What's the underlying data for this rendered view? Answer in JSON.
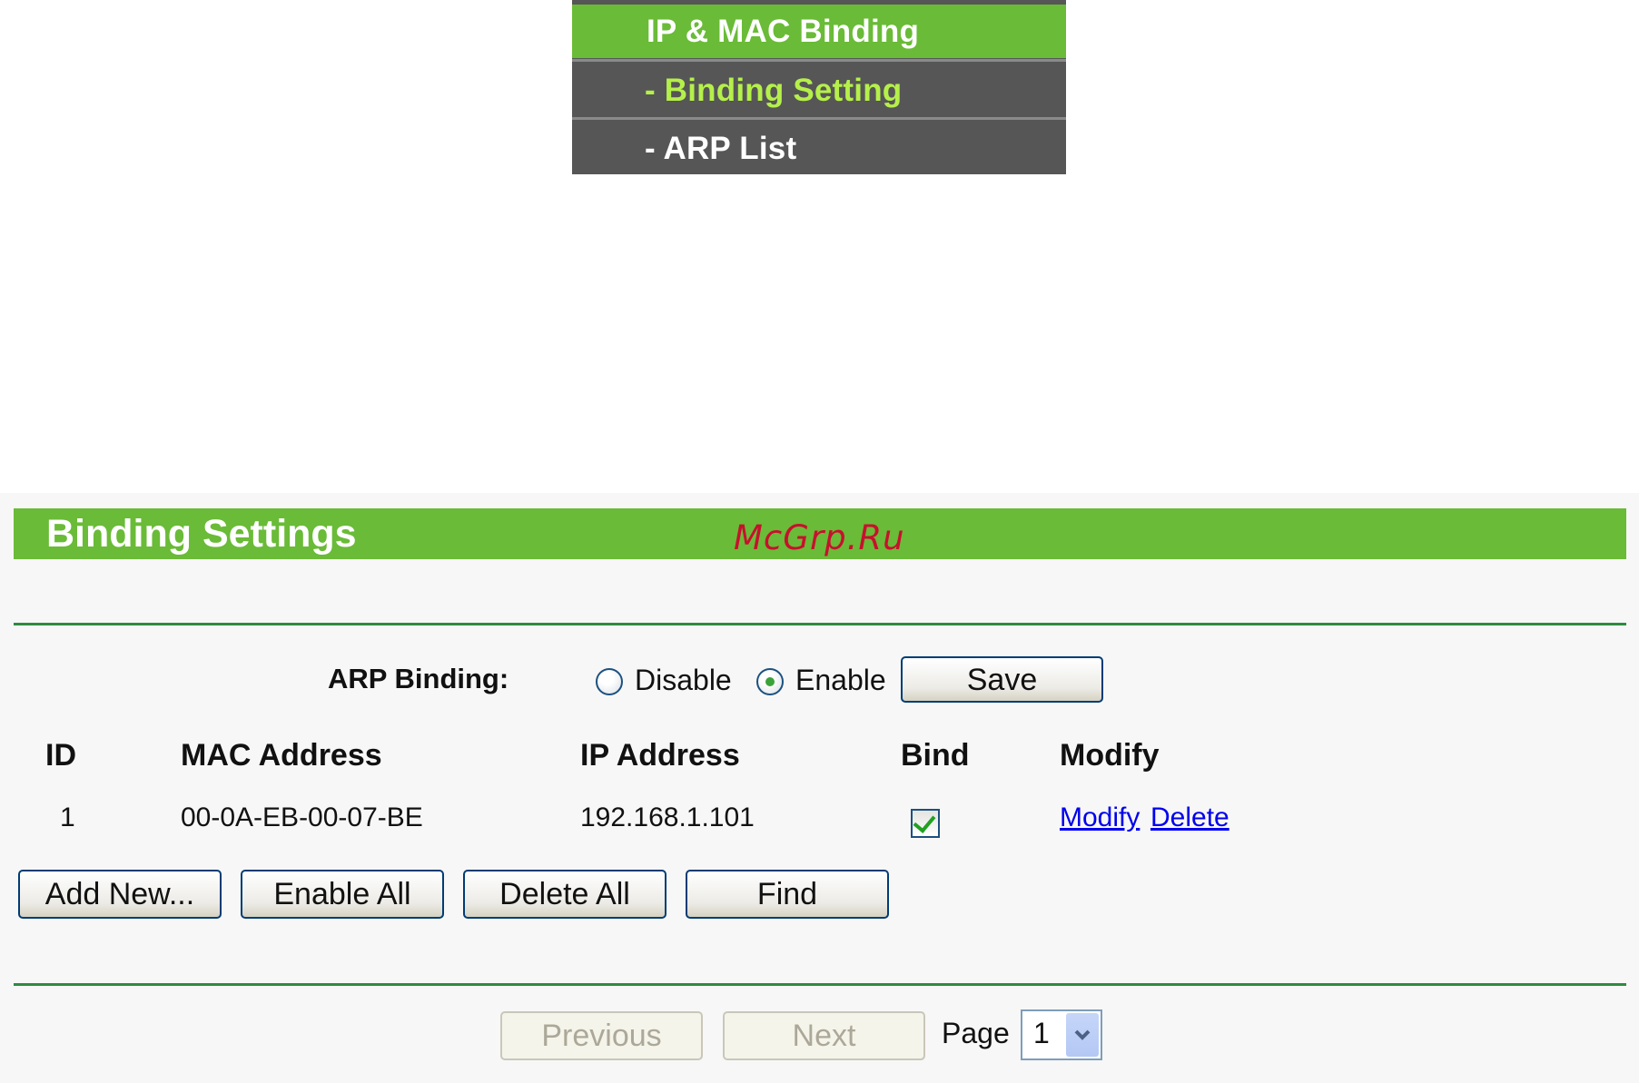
{
  "menu": {
    "header": "IP & MAC Binding",
    "items": [
      {
        "label": "- Binding Setting",
        "active": true
      },
      {
        "label": "- ARP List",
        "active": false
      }
    ]
  },
  "panel": {
    "title": "Binding Settings",
    "watermark": "McGrp.Ru",
    "arp_binding": {
      "label": "ARP Binding:",
      "options": [
        "Disable",
        "Enable"
      ],
      "selected": "Enable",
      "save_label": "Save"
    },
    "table": {
      "columns": [
        "ID",
        "MAC Address",
        "IP Address",
        "Bind",
        "Modify"
      ],
      "rows": [
        {
          "id": "1",
          "mac": "00-0A-EB-00-07-BE",
          "ip": "192.168.1.101",
          "bind": true,
          "actions": [
            "Modify",
            "Delete"
          ]
        }
      ]
    },
    "buttons": {
      "add_new": "Add New...",
      "enable_all": "Enable All",
      "delete_all": "Delete All",
      "find": "Find"
    },
    "pagination": {
      "previous": "Previous",
      "next": "Next",
      "page_label": "Page",
      "page_value": "1"
    }
  },
  "colors": {
    "accent_green": "#6abb37",
    "menu_bg": "#565656",
    "active_menu_text": "#b5f04a",
    "rule_green": "#2e8b3e"
  }
}
